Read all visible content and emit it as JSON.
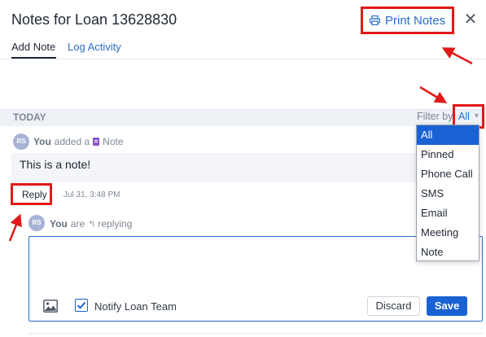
{
  "header": {
    "title": "Notes for Loan 13628830",
    "print_label": "Print Notes",
    "close_symbol": "✕",
    "icons": {
      "print": "printer-icon",
      "close": "close-icon"
    }
  },
  "tabs": [
    {
      "label": "Add Note",
      "active": true
    },
    {
      "label": "Log Activity",
      "active": false
    }
  ],
  "section": {
    "label": "TODAY"
  },
  "filter": {
    "label": "Filter by:",
    "value": "All",
    "options": [
      "All",
      "Pinned",
      "Phone Call",
      "SMS",
      "Email",
      "Meeting",
      "Note"
    ],
    "selected": "All"
  },
  "note": {
    "avatar_initials": "RS",
    "author": "You",
    "action": "added a",
    "type": "Note",
    "text": "This is a note!",
    "reply_label": "Reply",
    "separator": "·",
    "timestamp": "Jul 31, 3:48 PM"
  },
  "reply_composer": {
    "avatar_initials": "RS",
    "author": "You",
    "status_prefix": "are",
    "status": "replying",
    "value": "",
    "notify_label": "Notify Loan Team",
    "notify_checked": true,
    "discard_label": "Discard",
    "save_label": "Save"
  },
  "colors": {
    "link": "#2a6cc8",
    "primary": "#1a62d3",
    "annotation": "#e11919",
    "note_type": "#8a55c8",
    "avatar": "#a7b3d6"
  }
}
